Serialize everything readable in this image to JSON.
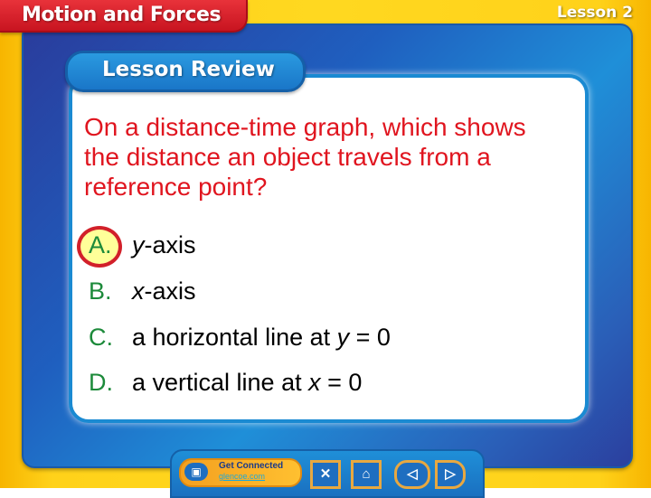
{
  "header": {
    "chapter_title": "Motion and Forces",
    "lesson_label": "Lesson 2"
  },
  "section_title": "Lesson Review",
  "question": "On a distance-time graph, which shows the distance an object travels from a reference point?",
  "answers": [
    {
      "letter": "A.",
      "pre": "",
      "italic": "y",
      "post": "-axis",
      "selected": true
    },
    {
      "letter": "B.",
      "pre": "",
      "italic": "x",
      "post": "-axis",
      "selected": false
    },
    {
      "letter": "C.",
      "pre": "a horizontal line at ",
      "italic": "y",
      "post": " = 0",
      "selected": false
    },
    {
      "letter": "D.",
      "pre": "a vertical line at ",
      "italic": "x",
      "post": " = 0",
      "selected": false
    }
  ],
  "navbar": {
    "get_connected": "Get Connected",
    "site": "glencoe.com",
    "icons": [
      "computer-icon",
      "close-icon",
      "home-icon",
      "previous-icon",
      "next-icon"
    ],
    "glyphs": {
      "close": "✕",
      "home": "⌂",
      "prev": "◁",
      "next": "▷",
      "computer": "▣"
    }
  },
  "colors": {
    "question": "#e0151f",
    "letter": "#1c8a3a",
    "highlight": "#ffff99",
    "ring": "#d2202a"
  }
}
